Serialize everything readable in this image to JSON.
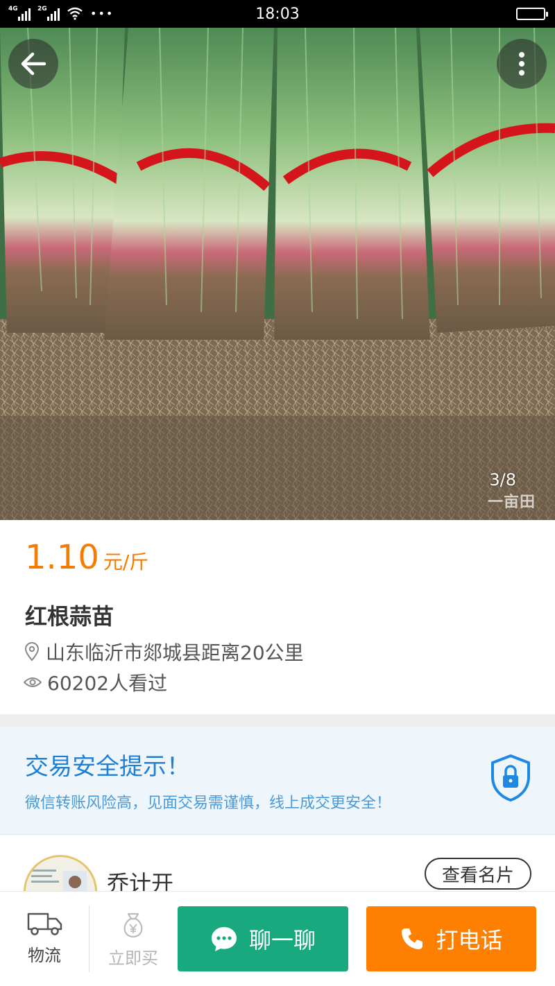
{
  "status_bar": {
    "time": "18:03",
    "network_1": "4G",
    "network_2": "2G",
    "dots": "•••"
  },
  "gallery": {
    "counter": "3/8",
    "watermark": "一亩田"
  },
  "product": {
    "price": "1.10",
    "unit": "元/斤",
    "name": "红根蒜苗",
    "location": "山东临沂市郯城县距离20公里",
    "views": "60202人看过",
    "price_color": "#f57c00"
  },
  "safety_tip": {
    "title": "交易安全提示！",
    "text": "微信转账风险高，见面交易需谨慎，线上成交更安全！"
  },
  "seller": {
    "name": "乔计开",
    "card_button": "查看名片"
  },
  "bottom_bar": {
    "logistics_label": "物流",
    "buy_label": "立即买",
    "chat_label": "聊一聊",
    "call_label": "打电话",
    "chat_color": "#18a97f",
    "call_color": "#ff8000"
  },
  "icons": [
    "back-arrow-icon",
    "more-vertical-icon",
    "location-pin-icon",
    "eye-icon",
    "shield-lock-icon",
    "truck-icon",
    "money-bag-icon",
    "chat-bubble-icon",
    "phone-icon"
  ]
}
